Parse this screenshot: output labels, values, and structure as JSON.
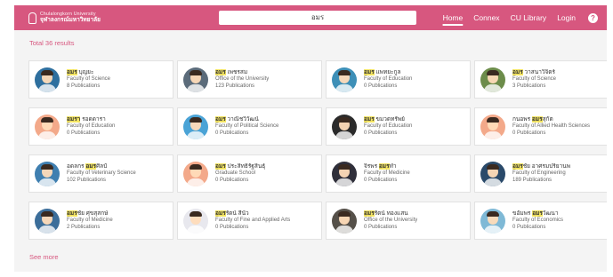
{
  "header": {
    "logo_en": "Chulalongkorn University",
    "logo_th": "จุฬาลงกรณ์มหาวิทยาลัย",
    "search_value": "อมร",
    "nav": [
      "Home",
      "Connex",
      "CU Library",
      "Login"
    ],
    "help_icon": "?"
  },
  "total_results": "Total 36 results",
  "see_more": "See more",
  "colors": {
    "brand": "#d7577f",
    "highlight": "#f5e663"
  },
  "people": [
    {
      "name_pre": "",
      "name_hl": "อมร",
      "name_post": " บุญยะ",
      "faculty": "Faculty of Science",
      "pubs": "8 Publications",
      "avatar_color": "#2e6f9e",
      "icon": "female-photo"
    },
    {
      "name_pre": "",
      "name_hl": "อมร",
      "name_post": " เพชรสม",
      "faculty": "Office of the University",
      "pubs": "123 Publications",
      "avatar_color": "#5b6b7a",
      "icon": "male-photo"
    },
    {
      "name_pre": "",
      "name_hl": "อมร",
      "name_post": " แพทยะกูล",
      "faculty": "Faculty of Education",
      "pubs": "0 Publications",
      "avatar_color": "#3d8fb7",
      "icon": "male-photo"
    },
    {
      "name_pre": "",
      "name_hl": "อมร",
      "name_post": " วาสนาวิจิตร์",
      "faculty": "Faculty of Science",
      "pubs": "3 Publications",
      "avatar_color": "#6c8c4a",
      "icon": "male-photo"
    },
    {
      "name_pre": "",
      "name_hl": "อมรา",
      "name_post": " รอดดารา",
      "faculty": "Faculty of Education",
      "pubs": "0 Publications",
      "avatar_color": "#f3a98a",
      "icon": "male-avatar"
    },
    {
      "name_pre": "",
      "name_hl": "อมร",
      "name_post": " วาณิชวิวัฒน์",
      "faculty": "Faculty of Political Science",
      "pubs": "0 Publications",
      "avatar_color": "#4aa3d6",
      "icon": "male-photo"
    },
    {
      "name_pre": "",
      "name_hl": "อมร",
      "name_post": " ขมวดทรัพย์",
      "faculty": "Faculty of Education",
      "pubs": "0 Publications",
      "avatar_color": "#2b2b2b",
      "icon": "male-photo"
    },
    {
      "name_pre": "กนอพร ",
      "name_hl": "อมร",
      "name_post": "สุกัต",
      "faculty": "Faculty of Allied Health Sciences",
      "pubs": "0 Publications",
      "avatar_color": "#f3a98a",
      "icon": "male-avatar"
    },
    {
      "name_pre": "อดลกร ",
      "name_hl": "อมร",
      "name_post": "ศิลป์",
      "faculty": "Faculty of Veterinary Science",
      "pubs": "102 Publications",
      "avatar_color": "#3f7fb0",
      "icon": "male-photo"
    },
    {
      "name_pre": "",
      "name_hl": "อมร",
      "name_post": " ประสิทธิ์รัฐสินธุ์",
      "faculty": "Graduate School",
      "pubs": "0 Publications",
      "avatar_color": "#f3a98a",
      "icon": "male-avatar"
    },
    {
      "name_pre": "จิรพร ",
      "name_hl": "อมร",
      "name_post": "ทำ",
      "faculty": "Faculty of Medicine",
      "pubs": "0 Publications",
      "avatar_color": "#2f2f3a",
      "icon": "female-photo"
    },
    {
      "name_pre": "",
      "name_hl": "อมร",
      "name_post": "ชัย อาศรมปริยานพ",
      "faculty": "Faculty of Engineering",
      "pubs": "189 Publications",
      "avatar_color": "#2a4a6a",
      "icon": "male-photo"
    },
    {
      "name_pre": "",
      "name_hl": "อมร",
      "name_post": "ชัย ศุขสุสกษ์",
      "faculty": "Faculty of Medicine",
      "pubs": "2 Publications",
      "avatar_color": "#3c6e9a",
      "icon": "male-photo"
    },
    {
      "name_pre": "",
      "name_hl": "อมร",
      "name_post": "รัตน์ สีนัว",
      "faculty": "Faculty of Fine and Applied Arts",
      "pubs": "0 Publications",
      "avatar_color": "#e8e8ee",
      "icon": "female-photo"
    },
    {
      "name_pre": "",
      "name_hl": "อมร",
      "name_post": "รัตน์ ทองแสน",
      "faculty": "Office of the University",
      "pubs": "0 Publications",
      "avatar_color": "#555049",
      "icon": "female-photo"
    },
    {
      "name_pre": "ขอัมพร ",
      "name_hl": "อมร",
      "name_post": "วัฒนา",
      "faculty": "Faculty of Economics",
      "pubs": "0 Publications",
      "avatar_color": "#7fb9d6",
      "icon": "female-photo"
    }
  ]
}
